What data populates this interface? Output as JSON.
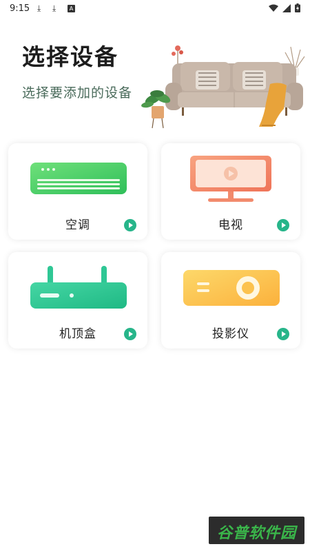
{
  "status_bar": {
    "time": "9:15",
    "icons": [
      "download-icon",
      "download-icon",
      "a-icon",
      "wifi-icon",
      "signal-icon",
      "battery-icon"
    ]
  },
  "header": {
    "title": "选择设备",
    "subtitle": "选择要添加的设备"
  },
  "devices": [
    {
      "label": "空调",
      "icon": "air-conditioner-icon"
    },
    {
      "label": "电视",
      "icon": "tv-icon"
    },
    {
      "label": "机顶盒",
      "icon": "set-top-box-icon"
    },
    {
      "label": "投影仪",
      "icon": "projector-icon"
    }
  ],
  "watermark": {
    "text": "谷普软件园"
  },
  "colors": {
    "accent": "#27b58a",
    "subtitle": "#4a6b5b",
    "ac_green": "#4fd16b",
    "tv_orange": "#f4876a",
    "stb_green": "#2fc795",
    "projector_yellow": "#fcc24e"
  }
}
